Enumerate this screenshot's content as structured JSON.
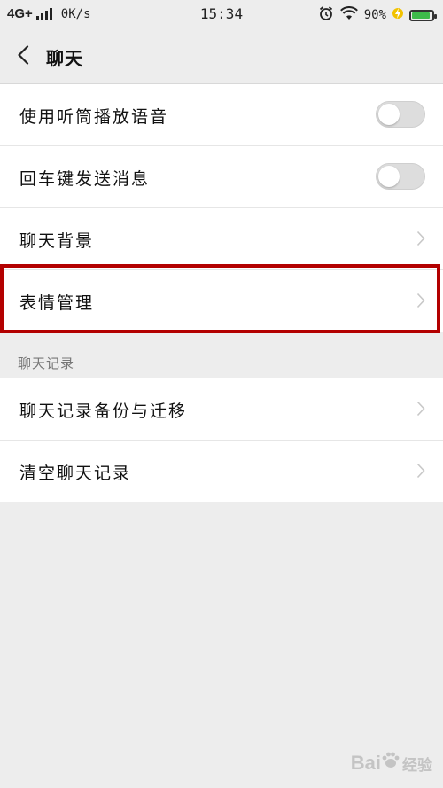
{
  "status_bar": {
    "network": "4G+",
    "speed": "0K/s",
    "time": "15:34",
    "battery": "90%",
    "battery_level": 0.9,
    "accent_battery": "#3dbb4a"
  },
  "nav": {
    "title": "聊天",
    "back_icon": "chevron-left-icon"
  },
  "settings": {
    "items": [
      {
        "label": "使用听筒播放语音",
        "control": "toggle",
        "on": false
      },
      {
        "label": "回车键发送消息",
        "control": "toggle",
        "on": false
      },
      {
        "label": "聊天背景",
        "control": "chevron"
      },
      {
        "label": "表情管理",
        "control": "chevron",
        "highlighted": true
      }
    ]
  },
  "chat_history": {
    "header": "聊天记录",
    "items": [
      {
        "label": "聊天记录备份与迁移",
        "control": "chevron"
      },
      {
        "label": "清空聊天记录",
        "control": "chevron"
      }
    ]
  },
  "watermark": {
    "brand": "Bai",
    "sub": "经验"
  },
  "colors": {
    "highlight_border": "#b30000",
    "background": "#ededed"
  }
}
